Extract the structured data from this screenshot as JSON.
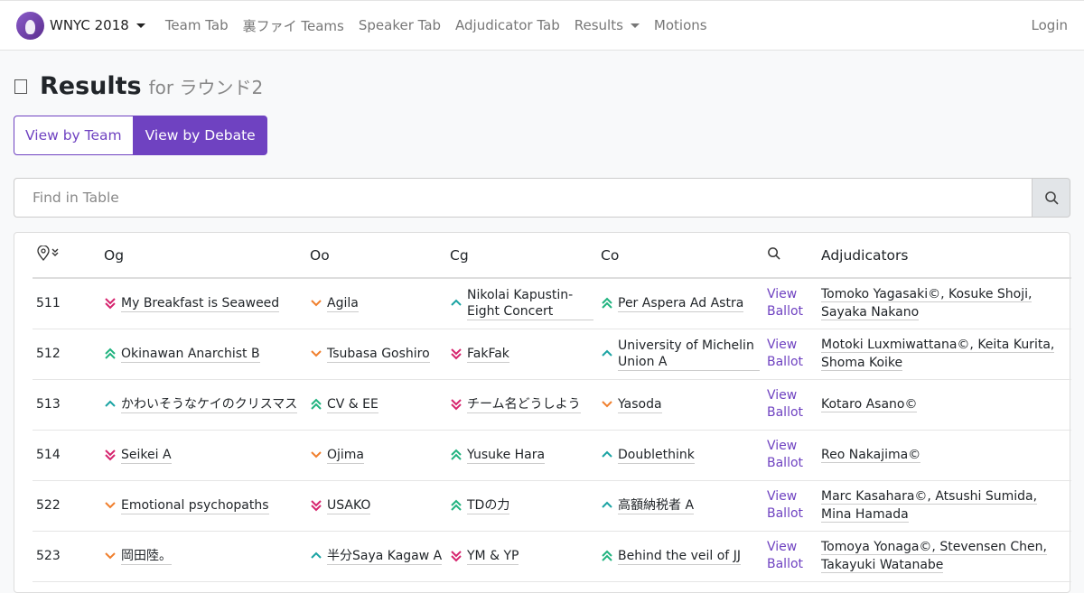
{
  "nav": {
    "brand": "WNYC 2018",
    "links": [
      "Team Tab",
      "裏ファイ Teams",
      "Speaker Tab",
      "Adjudicator Tab",
      "Results",
      "Motions"
    ],
    "login": "Login"
  },
  "page": {
    "title": "Results",
    "subtitle": "for ラウンド2"
  },
  "toggle": {
    "by_team": "View by Team",
    "by_debate": "View by Debate"
  },
  "search": {
    "placeholder": "Find in Table"
  },
  "table": {
    "headers": {
      "og": "Og",
      "oo": "Oo",
      "cg": "Cg",
      "co": "Co",
      "adjudicators": "Adjudicators"
    },
    "rows": [
      {
        "room": "511",
        "og": {
          "name": "My Breakfast is Seaweed",
          "rank": 4
        },
        "oo": {
          "name": "Agila",
          "rank": 3
        },
        "cg": {
          "name": "Nikolai Kapustin-Eight Concert",
          "rank": 2
        },
        "co": {
          "name": "Per Aspera Ad Astra",
          "rank": 1
        },
        "ballot": "View Ballot",
        "adjs": "Tomoko Yagasaki©, Kosuke Shoji, Sayaka Nakano"
      },
      {
        "room": "512",
        "og": {
          "name": "Okinawan Anarchist B",
          "rank": 1
        },
        "oo": {
          "name": "Tsubasa Goshiro",
          "rank": 3
        },
        "cg": {
          "name": "FakFak",
          "rank": 4
        },
        "co": {
          "name": "University of Michelin Union A",
          "rank": 2
        },
        "ballot": "View Ballot",
        "adjs": "Motoki Luxmiwattana©, Keita Kurita, Shoma Koike"
      },
      {
        "room": "513",
        "og": {
          "name": "かわいそうなケイのクリスマス",
          "rank": 2
        },
        "oo": {
          "name": "CV & EE",
          "rank": 1
        },
        "cg": {
          "name": "チーム名どうしよう",
          "rank": 4
        },
        "co": {
          "name": "Yasoda",
          "rank": 3
        },
        "ballot": "View Ballot",
        "adjs": "Kotaro Asano©"
      },
      {
        "room": "514",
        "og": {
          "name": "Seikei A",
          "rank": 4
        },
        "oo": {
          "name": "Ojima",
          "rank": 3
        },
        "cg": {
          "name": "Yusuke Hara",
          "rank": 1
        },
        "co": {
          "name": "Doublethink",
          "rank": 2
        },
        "ballot": "View Ballot",
        "adjs": "Reo Nakajima©"
      },
      {
        "room": "522",
        "og": {
          "name": "Emotional psychopaths",
          "rank": 3
        },
        "oo": {
          "name": "USAKO",
          "rank": 4
        },
        "cg": {
          "name": "TDの力",
          "rank": 1
        },
        "co": {
          "name": "高額納税者 A",
          "rank": 2
        },
        "ballot": "View Ballot",
        "adjs": "Marc Kasahara©, Atsushi Sumida, Mina Hamada"
      },
      {
        "room": "523",
        "og": {
          "name": "岡田陸。",
          "rank": 3
        },
        "oo": {
          "name": "半分Saya Kagaw A",
          "rank": 2
        },
        "cg": {
          "name": "YM & YP",
          "rank": 4
        },
        "co": {
          "name": "Behind the veil of JJ",
          "rank": 1
        },
        "ballot": "View Ballot",
        "adjs": "Tomoya Yonaga©, Stevensen Chen, Takayuki Watanabe"
      }
    ]
  },
  "colors": {
    "accent": "#6f42c1",
    "rank1": "#20b37f",
    "rank2": "#1aa3a3",
    "rank3": "#f07f2d",
    "rank4": "#d6246e"
  }
}
